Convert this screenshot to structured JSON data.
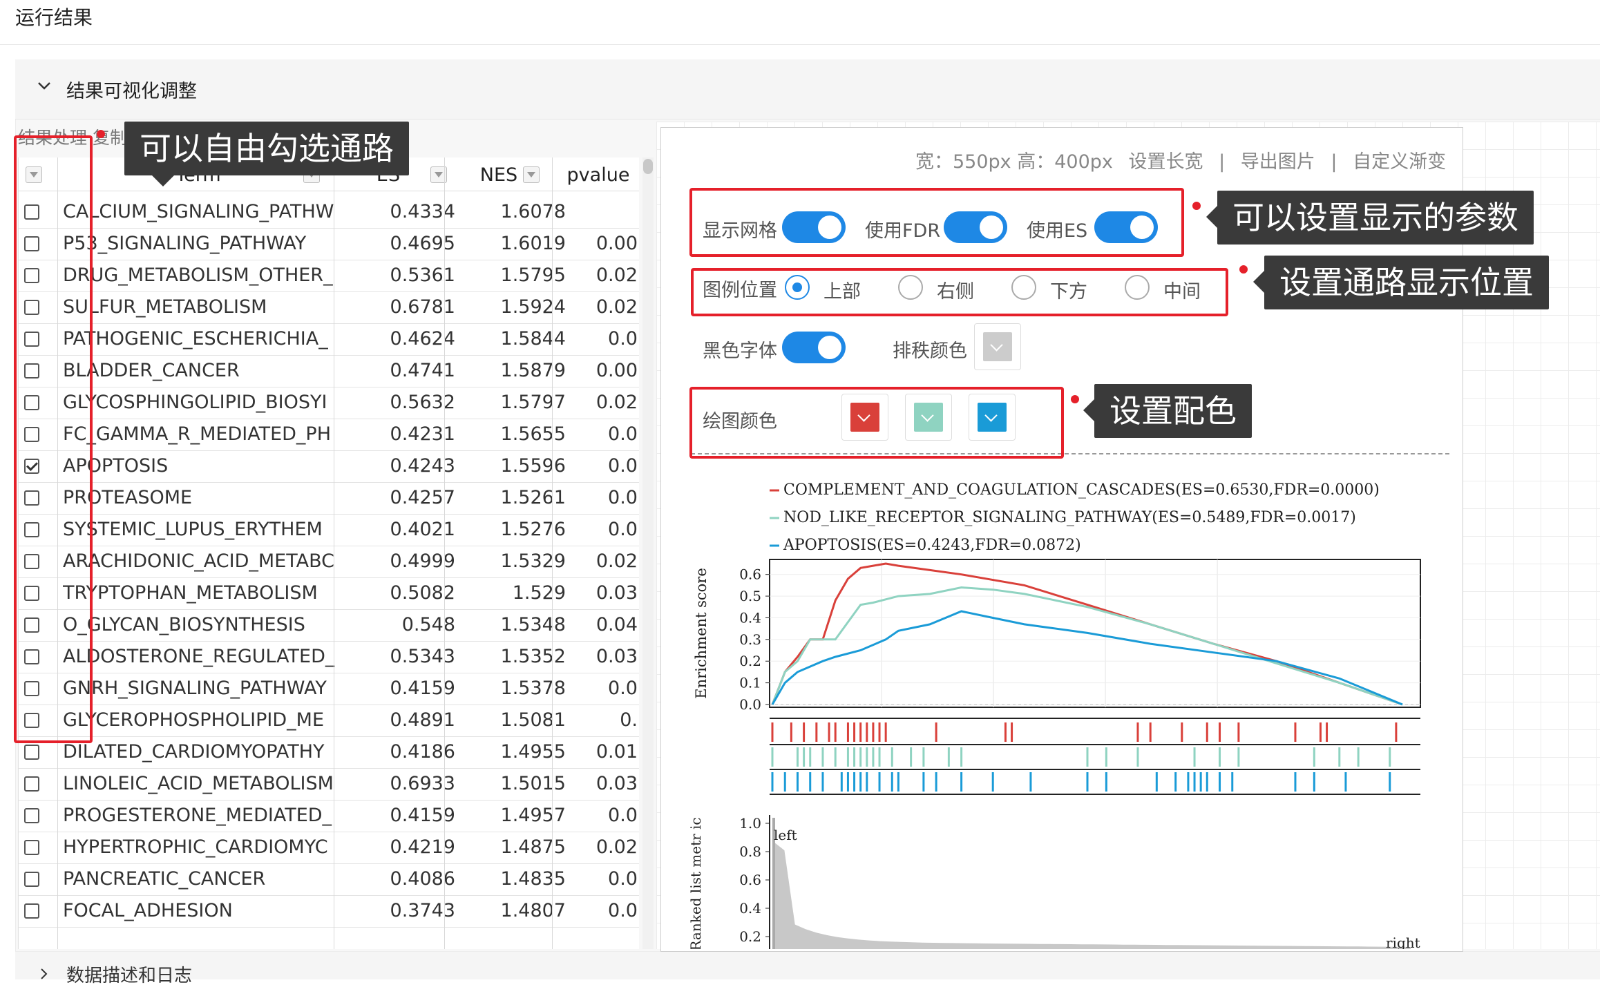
{
  "page_title": "运行结果",
  "panel": {
    "title": "结果可视化调整",
    "hint": "结果处理 复制全部结果"
  },
  "table": {
    "headers": {
      "term": "Term",
      "es": "ES",
      "nes": "NES",
      "pvalue": "pvalue"
    },
    "rows": [
      {
        "term": "CALCIUM_SIGNALING_PATHW",
        "es": "0.4334",
        "nes": "1.6078",
        "pvalue": "",
        "checked": false
      },
      {
        "term": "P53_SIGNALING_PATHWAY",
        "es": "0.4695",
        "nes": "1.6019",
        "pvalue": "0.00",
        "checked": false
      },
      {
        "term": "DRUG_METABOLISM_OTHER_",
        "es": "0.5361",
        "nes": "1.5795",
        "pvalue": "0.02",
        "checked": false
      },
      {
        "term": "SULFUR_METABOLISM",
        "es": "0.6781",
        "nes": "1.5924",
        "pvalue": "0.02",
        "checked": false
      },
      {
        "term": "PATHOGENIC_ESCHERICHIA_",
        "es": "0.4624",
        "nes": "1.5844",
        "pvalue": "0.0",
        "checked": false
      },
      {
        "term": "BLADDER_CANCER",
        "es": "0.4741",
        "nes": "1.5879",
        "pvalue": "0.00",
        "checked": false
      },
      {
        "term": "GLYCOSPHINGOLIPID_BIOSYI",
        "es": "0.5632",
        "nes": "1.5797",
        "pvalue": "0.02",
        "checked": false
      },
      {
        "term": "FC_GAMMA_R_MEDIATED_PH",
        "es": "0.4231",
        "nes": "1.5655",
        "pvalue": "0.0",
        "checked": false
      },
      {
        "term": "APOPTOSIS",
        "es": "0.4243",
        "nes": "1.5596",
        "pvalue": "0.0",
        "checked": true
      },
      {
        "term": "PROTEASOME",
        "es": "0.4257",
        "nes": "1.5261",
        "pvalue": "0.0",
        "checked": false
      },
      {
        "term": "SYSTEMIC_LUPUS_ERYTHEM",
        "es": "0.4021",
        "nes": "1.5276",
        "pvalue": "0.0",
        "checked": false
      },
      {
        "term": "ARACHIDONIC_ACID_METABC",
        "es": "0.4999",
        "nes": "1.5329",
        "pvalue": "0.02",
        "checked": false
      },
      {
        "term": "TRYPTOPHAN_METABOLISM",
        "es": "0.5082",
        "nes": "1.529",
        "pvalue": "0.03",
        "checked": false
      },
      {
        "term": "O_GLYCAN_BIOSYNTHESIS",
        "es": "0.548",
        "nes": "1.5348",
        "pvalue": "0.04",
        "checked": false
      },
      {
        "term": "ALDOSTERONE_REGULATED_",
        "es": "0.5343",
        "nes": "1.5352",
        "pvalue": "0.03",
        "checked": false
      },
      {
        "term": "GNRH_SIGNALING_PATHWAY",
        "es": "0.4159",
        "nes": "1.5378",
        "pvalue": "0.0",
        "checked": false
      },
      {
        "term": "GLYCEROPHOSPHOLIPID_ME",
        "es": "0.4891",
        "nes": "1.5081",
        "pvalue": "0.",
        "checked": false
      },
      {
        "term": "DILATED_CARDIOMYOPATHY",
        "es": "0.4186",
        "nes": "1.4955",
        "pvalue": "0.01",
        "checked": false
      },
      {
        "term": "LINOLEIC_ACID_METABOLISM",
        "es": "0.6933",
        "nes": "1.5015",
        "pvalue": "0.03",
        "checked": false
      },
      {
        "term": "PROGESTERONE_MEDIATED_",
        "es": "0.4159",
        "nes": "1.4957",
        "pvalue": "0.0",
        "checked": false
      },
      {
        "term": "HYPERTROPHIC_CARDIOMYC",
        "es": "0.4219",
        "nes": "1.4875",
        "pvalue": "0.02",
        "checked": false
      },
      {
        "term": "PANCREATIC_CANCER",
        "es": "0.4086",
        "nes": "1.4835",
        "pvalue": "0.0",
        "checked": false
      },
      {
        "term": "FOCAL_ADHESION",
        "es": "0.3743",
        "nes": "1.4807",
        "pvalue": "0.0",
        "checked": false
      }
    ]
  },
  "toolbar": {
    "size": "宽：550px 高：400px",
    "set_size": "设置长宽",
    "sep": "|",
    "export": "导出图片",
    "gradient": "自定义渐变"
  },
  "settings": {
    "show_grid": "显示网格",
    "use_fdr": "使用FDR",
    "use_es": "使用ES",
    "legend_pos": "图例位置",
    "legend_options": [
      "上部",
      "右侧",
      "下方",
      "中间"
    ],
    "legend_selected": "上部",
    "black_font": "黑色字体",
    "rank_color": "排秩颜色",
    "plot_color": "绘图颜色",
    "colors": {
      "red": "#d9403a",
      "teal": "#8fd3c1",
      "blue": "#1a9bd7",
      "gray": "#cccccc"
    }
  },
  "annotations": {
    "select": "可以自由勾选通路",
    "params": "可以设置显示的参数",
    "position": "设置通路显示位置",
    "colors": "设置配色"
  },
  "bottom": {
    "title": "数据描述和日志"
  },
  "chart_data": {
    "type": "line",
    "legend": [
      {
        "name": "COMPLEMENT_AND_COAGULATION_CASCADES(ES=0.6530,FDR=0.0000)",
        "color": "#d9403a"
      },
      {
        "name": "NOD_LIKE_RECEPTOR_SIGNALING_PATHWAY(ES=0.5489,FDR=0.0017)",
        "color": "#8fd3c1"
      },
      {
        "name": "APOPTOSIS(ES=0.4243,FDR=0.0872)",
        "color": "#1a9bd7"
      }
    ],
    "ylabel": "Enrichment score",
    "ylabel2": "Ranked list metr ic",
    "yticks": [
      "0.6",
      "0.5",
      "0.4",
      "0.3",
      "0.2",
      "0.1",
      "0.0"
    ],
    "yticks2": [
      "1.0",
      "0.8",
      "0.6",
      "0.4",
      "0.2"
    ],
    "ylim": [
      0,
      0.65
    ],
    "left_label": "left",
    "right_label": "right",
    "series": [
      {
        "color": "#d9403a",
        "x": [
          0,
          0.02,
          0.04,
          0.06,
          0.08,
          0.1,
          0.12,
          0.14,
          0.16,
          0.18,
          0.2,
          0.25,
          0.3,
          0.4,
          0.5,
          0.6,
          0.7,
          0.8,
          0.9,
          1.0
        ],
        "y": [
          0,
          0.15,
          0.22,
          0.3,
          0.3,
          0.48,
          0.58,
          0.63,
          0.64,
          0.65,
          0.64,
          0.62,
          0.6,
          0.55,
          0.46,
          0.37,
          0.28,
          0.2,
          0.1,
          0
        ]
      },
      {
        "color": "#8fd3c1",
        "x": [
          0,
          0.02,
          0.04,
          0.06,
          0.1,
          0.12,
          0.14,
          0.16,
          0.2,
          0.25,
          0.3,
          0.35,
          0.4,
          0.5,
          0.6,
          0.7,
          0.8,
          0.9,
          1.0
        ],
        "y": [
          0,
          0.15,
          0.2,
          0.3,
          0.3,
          0.38,
          0.46,
          0.47,
          0.5,
          0.51,
          0.54,
          0.53,
          0.51,
          0.45,
          0.37,
          0.28,
          0.19,
          0.1,
          0
        ]
      },
      {
        "color": "#1a9bd7",
        "x": [
          0,
          0.02,
          0.04,
          0.08,
          0.1,
          0.14,
          0.18,
          0.2,
          0.25,
          0.3,
          0.35,
          0.4,
          0.5,
          0.6,
          0.7,
          0.8,
          0.9,
          1.0
        ],
        "y": [
          0,
          0.1,
          0.15,
          0.2,
          0.22,
          0.25,
          0.3,
          0.34,
          0.37,
          0.43,
          0.4,
          0.37,
          0.33,
          0.28,
          0.24,
          0.2,
          0.12,
          0
        ]
      }
    ],
    "hits": {
      "red": [
        0.0,
        0.03,
        0.05,
        0.07,
        0.09,
        0.1,
        0.12,
        0.13,
        0.14,
        0.15,
        0.16,
        0.17,
        0.18,
        0.26,
        0.37,
        0.38,
        0.58,
        0.6,
        0.65,
        0.69,
        0.71,
        0.74,
        0.83,
        0.87,
        0.88,
        0.99
      ],
      "teal": [
        0.0,
        0.04,
        0.05,
        0.06,
        0.08,
        0.1,
        0.12,
        0.13,
        0.14,
        0.15,
        0.16,
        0.17,
        0.19,
        0.22,
        0.24,
        0.28,
        0.3,
        0.5,
        0.53,
        0.58,
        0.67,
        0.71,
        0.74,
        0.86,
        0.9,
        0.93,
        0.98
      ],
      "blue": [
        0.0,
        0.02,
        0.04,
        0.06,
        0.08,
        0.11,
        0.12,
        0.13,
        0.14,
        0.15,
        0.17,
        0.19,
        0.2,
        0.24,
        0.26,
        0.3,
        0.35,
        0.41,
        0.5,
        0.53,
        0.61,
        0.64,
        0.66,
        0.67,
        0.68,
        0.69,
        0.71,
        0.73,
        0.83,
        0.86,
        0.91,
        0.98
      ]
    }
  }
}
